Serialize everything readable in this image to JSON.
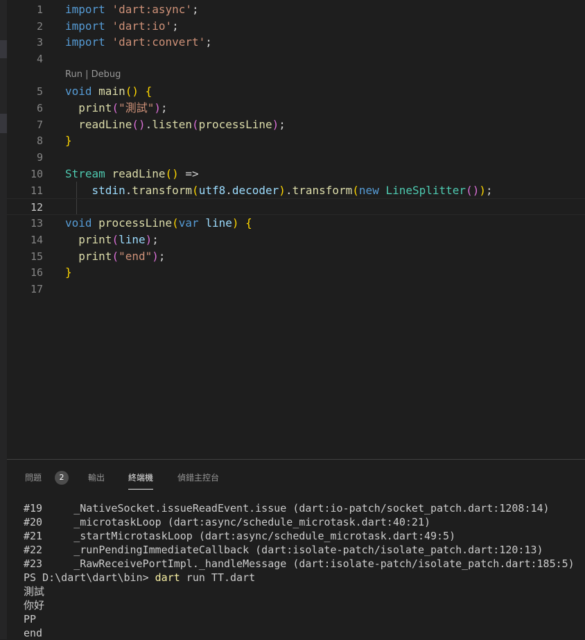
{
  "editor": {
    "codelens": {
      "run": "Run",
      "separator": " | ",
      "debug": "Debug"
    },
    "lines": [
      {
        "n": "1",
        "tokens": [
          [
            "k",
            "import"
          ],
          [
            "p",
            " "
          ],
          [
            "s",
            "'dart:async'"
          ],
          [
            "p",
            ";"
          ]
        ]
      },
      {
        "n": "2",
        "tokens": [
          [
            "k",
            "import"
          ],
          [
            "p",
            " "
          ],
          [
            "s",
            "'dart:io'"
          ],
          [
            "p",
            ";"
          ]
        ]
      },
      {
        "n": "3",
        "tokens": [
          [
            "k",
            "import"
          ],
          [
            "p",
            " "
          ],
          [
            "s",
            "'dart:convert'"
          ],
          [
            "p",
            ";"
          ]
        ]
      },
      {
        "n": "4",
        "tokens": []
      },
      {
        "n": "5",
        "tokens": [
          [
            "k",
            "void"
          ],
          [
            "p",
            " "
          ],
          [
            "f",
            "main"
          ],
          [
            "b1",
            "()"
          ],
          [
            "p",
            " "
          ],
          [
            "b1",
            "{"
          ]
        ]
      },
      {
        "n": "6",
        "tokens": [
          [
            "p",
            "  "
          ],
          [
            "f",
            "print"
          ],
          [
            "b2",
            "("
          ],
          [
            "s",
            "\"測試\""
          ],
          [
            "b2",
            ")"
          ],
          [
            "p",
            ";"
          ]
        ]
      },
      {
        "n": "7",
        "tokens": [
          [
            "p",
            "  "
          ],
          [
            "f",
            "readLine"
          ],
          [
            "b2",
            "()"
          ],
          [
            "p",
            "."
          ],
          [
            "f",
            "listen"
          ],
          [
            "b2",
            "("
          ],
          [
            "f",
            "processLine"
          ],
          [
            "b2",
            ")"
          ],
          [
            "p",
            ";"
          ]
        ]
      },
      {
        "n": "8",
        "tokens": [
          [
            "b1",
            "}"
          ]
        ]
      },
      {
        "n": "9",
        "tokens": []
      },
      {
        "n": "10",
        "tokens": [
          [
            "t",
            "Stream"
          ],
          [
            "p",
            " "
          ],
          [
            "f",
            "readLine"
          ],
          [
            "b1",
            "()"
          ],
          [
            "p",
            " =>"
          ]
        ]
      },
      {
        "n": "11",
        "tokens": [
          [
            "p",
            "    "
          ],
          [
            "v",
            "stdin"
          ],
          [
            "p",
            "."
          ],
          [
            "f",
            "transform"
          ],
          [
            "b1",
            "("
          ],
          [
            "v",
            "utf8"
          ],
          [
            "p",
            "."
          ],
          [
            "v",
            "decoder"
          ],
          [
            "b1",
            ")"
          ],
          [
            "p",
            "."
          ],
          [
            "f",
            "transform"
          ],
          [
            "b1",
            "("
          ],
          [
            "k",
            "new"
          ],
          [
            "p",
            " "
          ],
          [
            "t",
            "LineSplitter"
          ],
          [
            "b2",
            "()"
          ],
          [
            "b1",
            ")"
          ],
          [
            "p",
            ";"
          ]
        ]
      },
      {
        "n": "12",
        "tokens": []
      },
      {
        "n": "13",
        "tokens": [
          [
            "k",
            "void"
          ],
          [
            "p",
            " "
          ],
          [
            "f",
            "processLine"
          ],
          [
            "b1",
            "("
          ],
          [
            "k",
            "var"
          ],
          [
            "p",
            " "
          ],
          [
            "v",
            "line"
          ],
          [
            "b1",
            ")"
          ],
          [
            "p",
            " "
          ],
          [
            "b1",
            "{"
          ]
        ]
      },
      {
        "n": "14",
        "tokens": [
          [
            "p",
            "  "
          ],
          [
            "f",
            "print"
          ],
          [
            "b2",
            "("
          ],
          [
            "v",
            "line"
          ],
          [
            "b2",
            ")"
          ],
          [
            "p",
            ";"
          ]
        ]
      },
      {
        "n": "15",
        "tokens": [
          [
            "p",
            "  "
          ],
          [
            "f",
            "print"
          ],
          [
            "b2",
            "("
          ],
          [
            "s",
            "\"end\""
          ],
          [
            "b2",
            ")"
          ],
          [
            "p",
            ";"
          ]
        ]
      },
      {
        "n": "16",
        "tokens": [
          [
            "b1",
            "}"
          ]
        ]
      },
      {
        "n": "17",
        "tokens": []
      }
    ],
    "current_line": "12"
  },
  "panel": {
    "tabs": [
      {
        "label": "問題",
        "active": false
      },
      {
        "label": "輸出",
        "active": false
      },
      {
        "label": "終端機",
        "active": true
      },
      {
        "label": "偵錯主控台",
        "active": false
      }
    ],
    "problems_count": "2",
    "terminal_lines": [
      "#19     _NativeSocket.issueReadEvent.issue (dart:io-patch/socket_patch.dart:1208:14)",
      "#20     _microtaskLoop (dart:async/schedule_microtask.dart:40:21)",
      "#21     _startMicrotaskLoop (dart:async/schedule_microtask.dart:49:5)",
      "#22     _runPendingImmediateCallback (dart:isolate-patch/isolate_patch.dart:120:13)",
      "#23     _RawReceivePortImpl._handleMessage (dart:isolate-patch/isolate_patch.dart:185:5)"
    ],
    "prompt": {
      "path": "PS D:\\dart\\dart\\bin> ",
      "command": "dart",
      "args": " run TT.dart"
    },
    "output_lines": [
      "測試",
      "你好",
      "PP",
      "end"
    ]
  },
  "colors": {
    "background": "#1e1e1e",
    "keyword": "#569cd6",
    "string": "#ce9178",
    "function": "#dcdcaa",
    "variable": "#9cdcfe",
    "type": "#4ec9b0",
    "command": "#f9f1a5"
  }
}
